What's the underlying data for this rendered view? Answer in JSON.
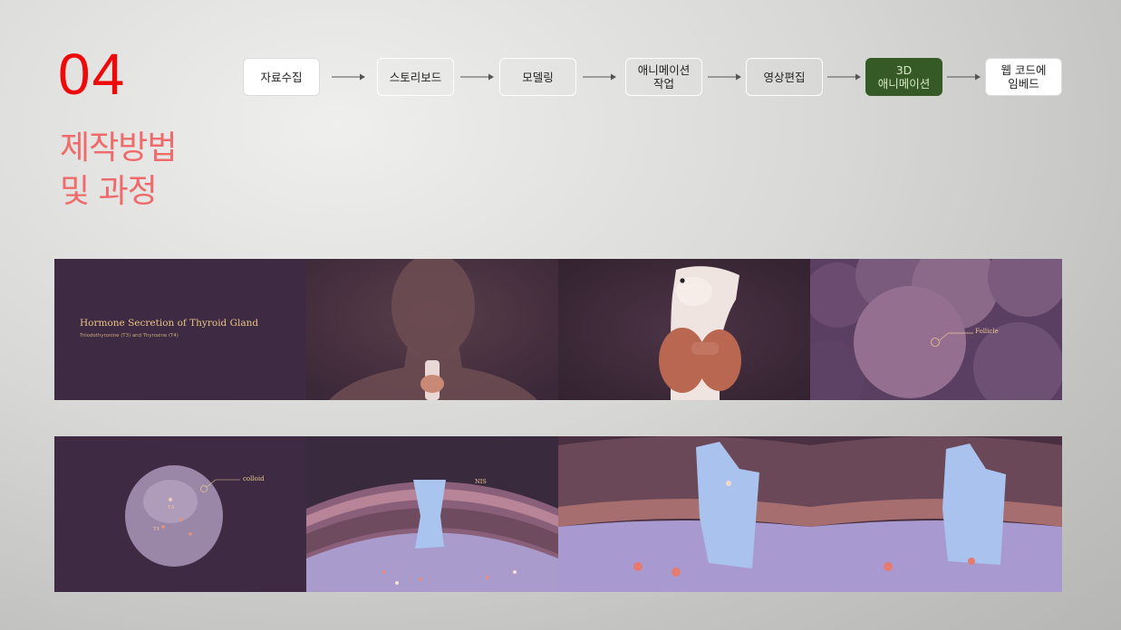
{
  "section": {
    "number": "04",
    "title_line1": "제작방법",
    "title_line2": "및 과정"
  },
  "process": {
    "steps": [
      {
        "label": "자료수집",
        "style": "filled"
      },
      {
        "label": "스토리보드",
        "style": "outlined"
      },
      {
        "label": "모델링",
        "style": "outlined"
      },
      {
        "label": "애니메이션\n작업",
        "style": "outlined"
      },
      {
        "label": "영상편집",
        "style": "outlined"
      },
      {
        "label": "3D\n애니메이션",
        "style": "active"
      },
      {
        "label": "웹 코드에\n임베드",
        "style": "filled"
      }
    ]
  },
  "frames": {
    "f1": {
      "title": "Hormone Secretion of Thyroid Gland",
      "subtitle": "Triiodothyronine (T3) and Thyroxine (T4)"
    },
    "f4": {
      "label": "Follicle"
    },
    "f5": {
      "label": "colloid",
      "t3": "T3",
      "t4": "T4"
    },
    "f6": {
      "label": "NIS"
    }
  },
  "colors": {
    "accent_number": "#ee0a0a",
    "accent_title": "#ef6b6b",
    "active_step": "#355a25",
    "frame_bg": "#3e2a42"
  }
}
